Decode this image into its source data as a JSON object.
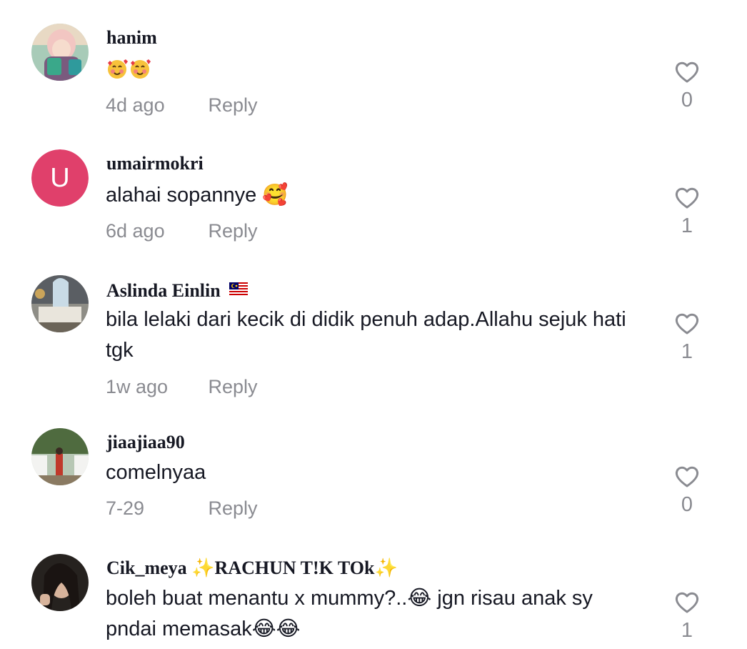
{
  "comments": [
    {
      "username": "hanim",
      "username_extra": "",
      "text": "🥰🥰",
      "time": "4d ago",
      "reply_label": "Reply",
      "likes": "0",
      "avatar": "photo"
    },
    {
      "username": "umairmokri",
      "username_extra": "",
      "text": "alahai sopannye 🥰",
      "time": "6d ago",
      "reply_label": "Reply",
      "likes": "1",
      "avatar": "letter",
      "avatar_letter": "U",
      "avatar_color": "#e0406b"
    },
    {
      "username": "Aslinda Einlin",
      "username_extra": "🇲🇾",
      "text": "bila lelaki dari kecik di didik penuh adap.Allahu sejuk hati tgk",
      "time": "1w ago",
      "reply_label": "Reply",
      "likes": "1",
      "avatar": "photo"
    },
    {
      "username": "jiaajiaa90",
      "username_extra": "",
      "text": "comelnyaa",
      "time": "7-29",
      "reply_label": "Reply",
      "likes": "0",
      "avatar": "photo"
    },
    {
      "username": "Cik_meya",
      "username_extra": "✨RACHUN T!K TOk✨",
      "text": "boleh buat menantu x mummy?..😂 jgn risau anak sy pndai memasak😂😂",
      "time": "",
      "reply_label": "",
      "likes": "1",
      "avatar": "photo"
    }
  ],
  "icons": {
    "like": "heart-outline-icon"
  },
  "colors": {
    "text": "#161823",
    "muted": "#8a8b91"
  }
}
